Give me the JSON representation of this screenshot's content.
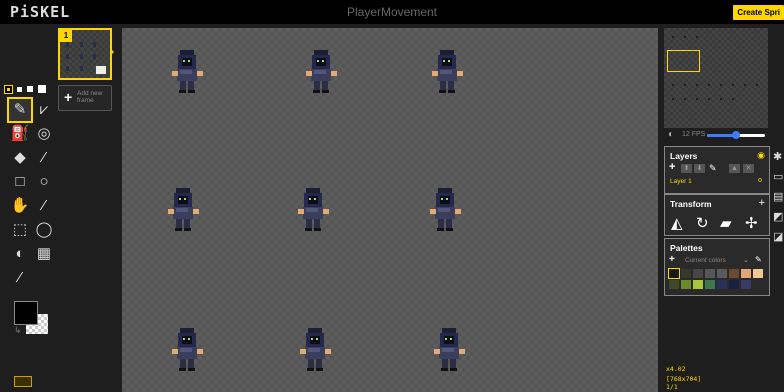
{
  "app": {
    "logo": "PiSKEL",
    "document_title": "PlayerMovement",
    "create_button": "Create Spri"
  },
  "frames": {
    "selected_index": "1",
    "add_new_frame_label": "Add new frame"
  },
  "tools": [
    {
      "name": "pen-tool-icon",
      "glyph": "✎",
      "active": true
    },
    {
      "name": "vertical-mirror-pen-icon",
      "glyph": "⩗",
      "active": false
    },
    {
      "name": "paint-bucket-icon",
      "glyph": "⛽",
      "active": false
    },
    {
      "name": "paint-all-same-color-icon",
      "glyph": "◎",
      "active": false
    },
    {
      "name": "eraser-icon",
      "glyph": "◆",
      "active": false
    },
    {
      "name": "stroke-icon",
      "glyph": "⁄",
      "active": false
    },
    {
      "name": "rectangle-icon",
      "glyph": "□",
      "active": false
    },
    {
      "name": "circle-icon",
      "glyph": "○",
      "active": false
    },
    {
      "name": "move-hand-icon",
      "glyph": "✋",
      "active": false
    },
    {
      "name": "shape-select-wand-icon",
      "glyph": "⁄",
      "active": false
    },
    {
      "name": "rectangle-select-icon",
      "glyph": "⬚",
      "active": false
    },
    {
      "name": "lasso-select-icon",
      "glyph": "◯",
      "active": false
    },
    {
      "name": "lighten-icon",
      "glyph": "◐",
      "active": false
    },
    {
      "name": "dithering-icon",
      "glyph": "▦",
      "active": false
    },
    {
      "name": "color-picker-icon",
      "glyph": "⁄",
      "active": false
    }
  ],
  "colors": {
    "primary": "#000000",
    "secondary": "transparent",
    "accent": "#ffd700",
    "slider": "#3d7bff"
  },
  "preview": {
    "fps_label": "12 FPS",
    "fps_value": 12,
    "fps_max": 24
  },
  "layers": {
    "title": "Layers",
    "active_layer": "Layer 1",
    "active_layer_opacity": "o"
  },
  "transform": {
    "title": "Transform"
  },
  "palettes": {
    "title": "Palettes",
    "current": "Current colors",
    "swatches": [
      "#1a1a10",
      "#343a2c",
      "#474747",
      "#565656",
      "#5a5a5a",
      "#6b4a35",
      "#e0a870",
      "#f0c890",
      "#3c4a2a",
      "#6a8a2a",
      "#a8c83a",
      "#3a7a4a",
      "#2a2e5a",
      "#1a2040",
      "#3a3a6a"
    ]
  },
  "status": {
    "zoom": "x4.02",
    "dimensions": "[768x704]",
    "frame": "1/1"
  }
}
